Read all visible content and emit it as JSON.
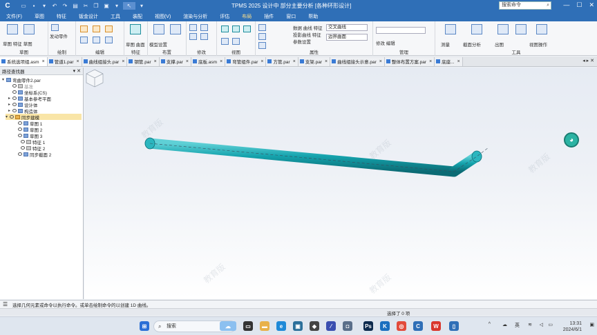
{
  "titlebar": {
    "app_logo": "C",
    "title": "TPMS 2025 设计中    部分主要分析    [各种环形设计]",
    "search_placeholder": "搜索命令",
    "min": "—",
    "max": "☐",
    "close": "✕"
  },
  "menubar": {
    "items": [
      "文件(F)",
      "草图",
      "特征",
      "钣金设计",
      "工具",
      "装配",
      "视图(V)",
      "渲染与分析",
      "评估",
      "布局",
      "插件",
      "窗口",
      "帮助"
    ],
    "active_index": 9
  },
  "ribbon": {
    "groups": [
      {
        "label": "草图"
      },
      {
        "label": "绘制"
      },
      {
        "label": "编辑"
      },
      {
        "label": "特征"
      },
      {
        "label": "布置"
      },
      {
        "label": "修改"
      },
      {
        "label": "视图"
      },
      {
        "label": "属性"
      },
      {
        "label": "管理"
      },
      {
        "label": "工具"
      }
    ],
    "texts": {
      "a": "草图 特征 草图",
      "b": "发动零件",
      "c": "草图 曲面",
      "d": "模型设置",
      "e": "数据 曲线 特征",
      "f": "投影曲线 特征",
      "g": "参数设置",
      "h": "交叉曲线",
      "i": "边界曲面",
      "j": "修改 编辑",
      "k": "测量",
      "l": "截面分析",
      "m": "出图",
      "n": "视图操作"
    }
  },
  "tabs": [
    {
      "label": "系统选项组.asm"
    },
    {
      "label": "管道1.par"
    },
    {
      "label": "曲线组接头.par"
    },
    {
      "label": "钢管.par"
    },
    {
      "label": "支撑.par"
    },
    {
      "label": "底板.asm"
    },
    {
      "label": "弯管组件.par"
    },
    {
      "label": "方管.par"
    },
    {
      "label": "支架.par"
    },
    {
      "label": "曲线组接头示意.par"
    },
    {
      "label": "整体布置方案.par"
    },
    {
      "label": "底座..."
    }
  ],
  "tree": {
    "title": "路径查找器",
    "root": "弯曲零件2.par",
    "items": [
      {
        "label": "基准",
        "gray": true
      },
      {
        "label": "坐标系(CS)",
        "gray": false
      },
      {
        "label": "基本参考平面",
        "gray": false
      },
      {
        "label": "设计体",
        "gray": false
      },
      {
        "label": "构造体",
        "gray": false
      },
      {
        "label": "同步建模",
        "gray": false
      },
      {
        "label": "草图 1"
      },
      {
        "label": "草图 2"
      },
      {
        "label": "草图 3"
      },
      {
        "label": "特征 1"
      },
      {
        "label": "特征 2"
      },
      {
        "label": "同步截面 2"
      }
    ]
  },
  "viewport": {
    "pipe_color": "#15a3ad",
    "watermarks": [
      "教育版",
      "教育版",
      "教育版",
      "教育版",
      "教育版"
    ]
  },
  "cmdbar": {
    "text": "选择几何元素或命令以执行命令。或单击绘制命令的以创建 1D 曲线。"
  },
  "statusbar": {
    "text": "选择了 0 项"
  },
  "taskbar": {
    "search": "搜索",
    "time": "13:31",
    "date": "2024/6/1",
    "lang": "英"
  }
}
